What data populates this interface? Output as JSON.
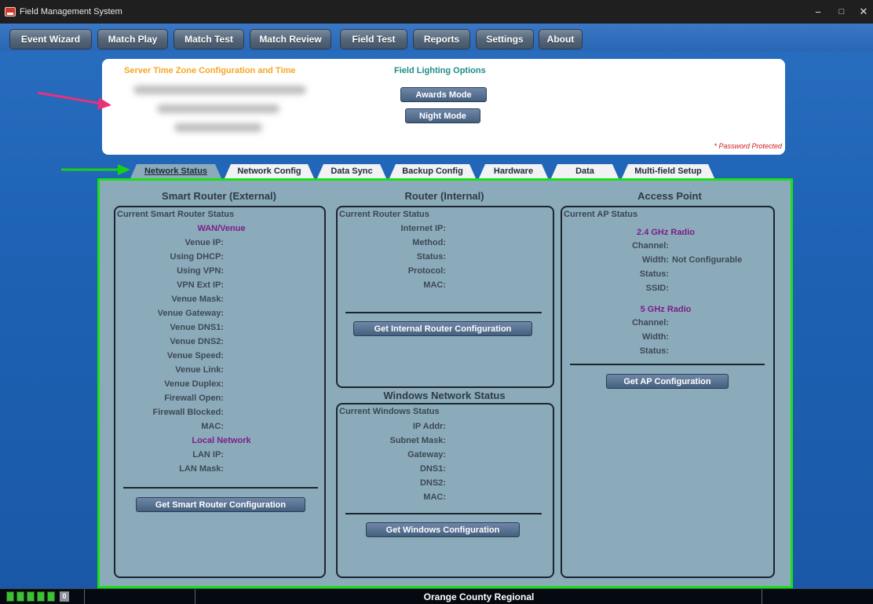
{
  "window": {
    "title": "Field Management System",
    "minimize": "−",
    "maximize": "□",
    "close": "✕"
  },
  "menu": [
    "Event Wizard",
    "Match Play",
    "Match Test",
    "Match Review",
    "Field Test",
    "Reports",
    "Settings",
    "About"
  ],
  "top_panel": {
    "tz_title": "Server Time Zone Configuration and Time",
    "lighting_title": "Field Lighting Options",
    "awards_button": "Awards Mode",
    "night_button": "Night Mode",
    "password_note": "* Password Protected"
  },
  "tabs": [
    "Network Status",
    "Network Config",
    "Data Sync",
    "Backup Config",
    "Hardware",
    "Data",
    "Multi-field Setup"
  ],
  "smart_router": {
    "title": "Smart Router (External)",
    "box_title": "Current Smart Router Status",
    "wan_heading": "WAN/Venue",
    "wan_fields": [
      "Venue IP:",
      "Using DHCP:",
      "Using VPN:",
      "VPN Ext IP:",
      "Venue Mask:",
      "Venue Gateway:",
      "Venue DNS1:",
      "Venue DNS2:",
      "Venue Speed:",
      "Venue Link:",
      "Venue Duplex:",
      "Firewall Open:",
      "Firewall Blocked:",
      "MAC:"
    ],
    "local_heading": "Local Network",
    "local_fields": [
      "LAN IP:",
      "LAN Mask:"
    ],
    "button": "Get Smart Router Configuration"
  },
  "router_internal": {
    "title": "Router (Internal)",
    "box_title": "Current Router Status",
    "fields": [
      "Internet IP:",
      "Method:",
      "Status:",
      "Protocol:",
      "MAC:"
    ],
    "button": "Get Internal Router Configuration"
  },
  "windows_network": {
    "title": "Windows Network Status",
    "box_title": "Current Windows Status",
    "fields": [
      "IP Addr:",
      "Subnet Mask:",
      "Gateway:",
      "DNS1:",
      "DNS2:",
      "MAC:"
    ],
    "button": "Get Windows Configuration"
  },
  "access_point": {
    "title": "Access Point",
    "box_title": "Current AP Status",
    "radio24_heading": "2.4 GHz Radio",
    "radio24_fields": [
      "Channel:",
      "Width:",
      "Status:",
      "SSID:"
    ],
    "radio24_width_value": "Not Configurable",
    "radio5_heading": "5 GHz Radio",
    "radio5_fields": [
      "Channel:",
      "Width:",
      "Status:"
    ],
    "button": "Get AP Configuration"
  },
  "statusbar": {
    "count": "0",
    "event_name": "Orange County Regional"
  },
  "colors": {
    "content_bg": "#8cabba",
    "highlight_border": "#18e018",
    "heading_purple": "#7a1f8a",
    "tz_orange": "#f6a623",
    "lighting_teal": "#1f8c88",
    "password_red": "#d11a1a"
  }
}
